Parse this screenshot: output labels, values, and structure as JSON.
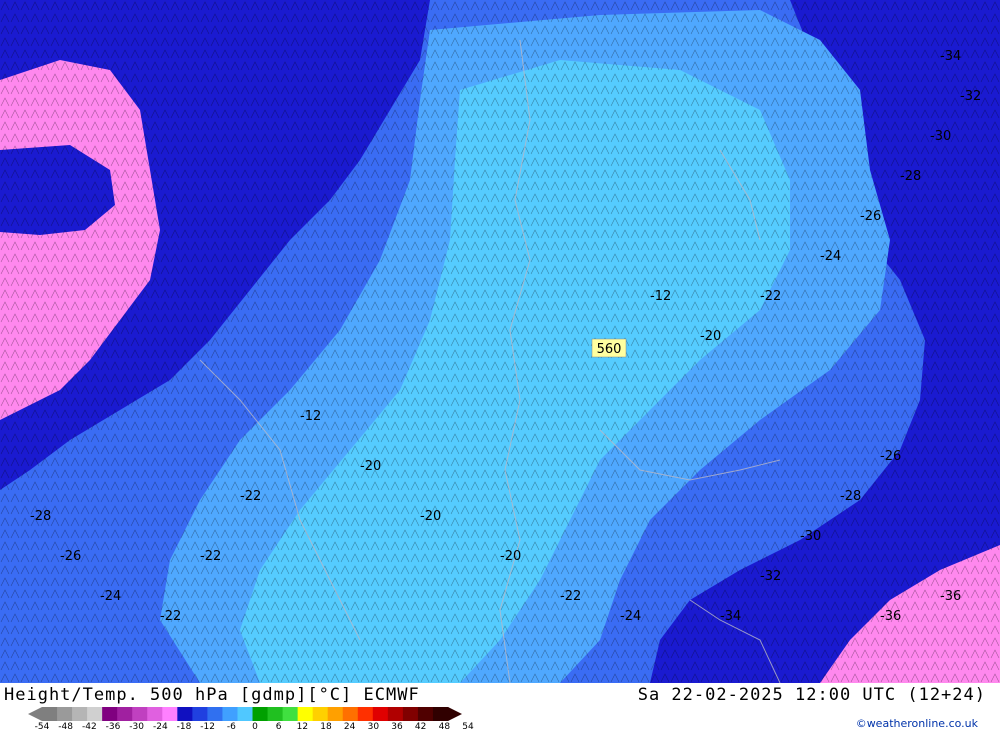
{
  "footer": {
    "title": "Height/Temp. 500 hPa [gdmp][°C] ECMWF",
    "datetime": "Sa 22-02-2025 12:00 UTC (12+24)",
    "credit": "©weatheronline.co.uk"
  },
  "colorbar": {
    "ticks": [
      "-54",
      "-48",
      "-42",
      "-36",
      "-30",
      "-24",
      "-18",
      "-12",
      "-6",
      "0",
      "6",
      "12",
      "18",
      "24",
      "30",
      "36",
      "42",
      "48",
      "54"
    ],
    "colors": [
      "#7f7f7f",
      "#9a9a9a",
      "#b5b5b5",
      "#d0d0d0",
      "#800080",
      "#a020a0",
      "#c040c0",
      "#e060e0",
      "#ff80ff",
      "#1010c0",
      "#2040e0",
      "#3070f0",
      "#40a0ff",
      "#50c8ff",
      "#00a000",
      "#20c020",
      "#40e040",
      "#ffff00",
      "#ffd000",
      "#ffa000",
      "#ff7000",
      "#ff3000",
      "#e00000",
      "#b00000",
      "#800000",
      "#500000",
      "#300000"
    ]
  },
  "map": {
    "height_label": "560",
    "temperature_labels": [
      "-12",
      "-20",
      "-22",
      "-24",
      "-26",
      "-28",
      "-30",
      "-32",
      "-34",
      "-36"
    ],
    "colors": {
      "pink": "#ff88ee",
      "dark_blue": "#1a1ad0",
      "medium_blue": "#3a6cf4",
      "light_blue": "#4fa8ff",
      "cyan": "#55ccff",
      "label_box": "#ffffa0"
    }
  }
}
